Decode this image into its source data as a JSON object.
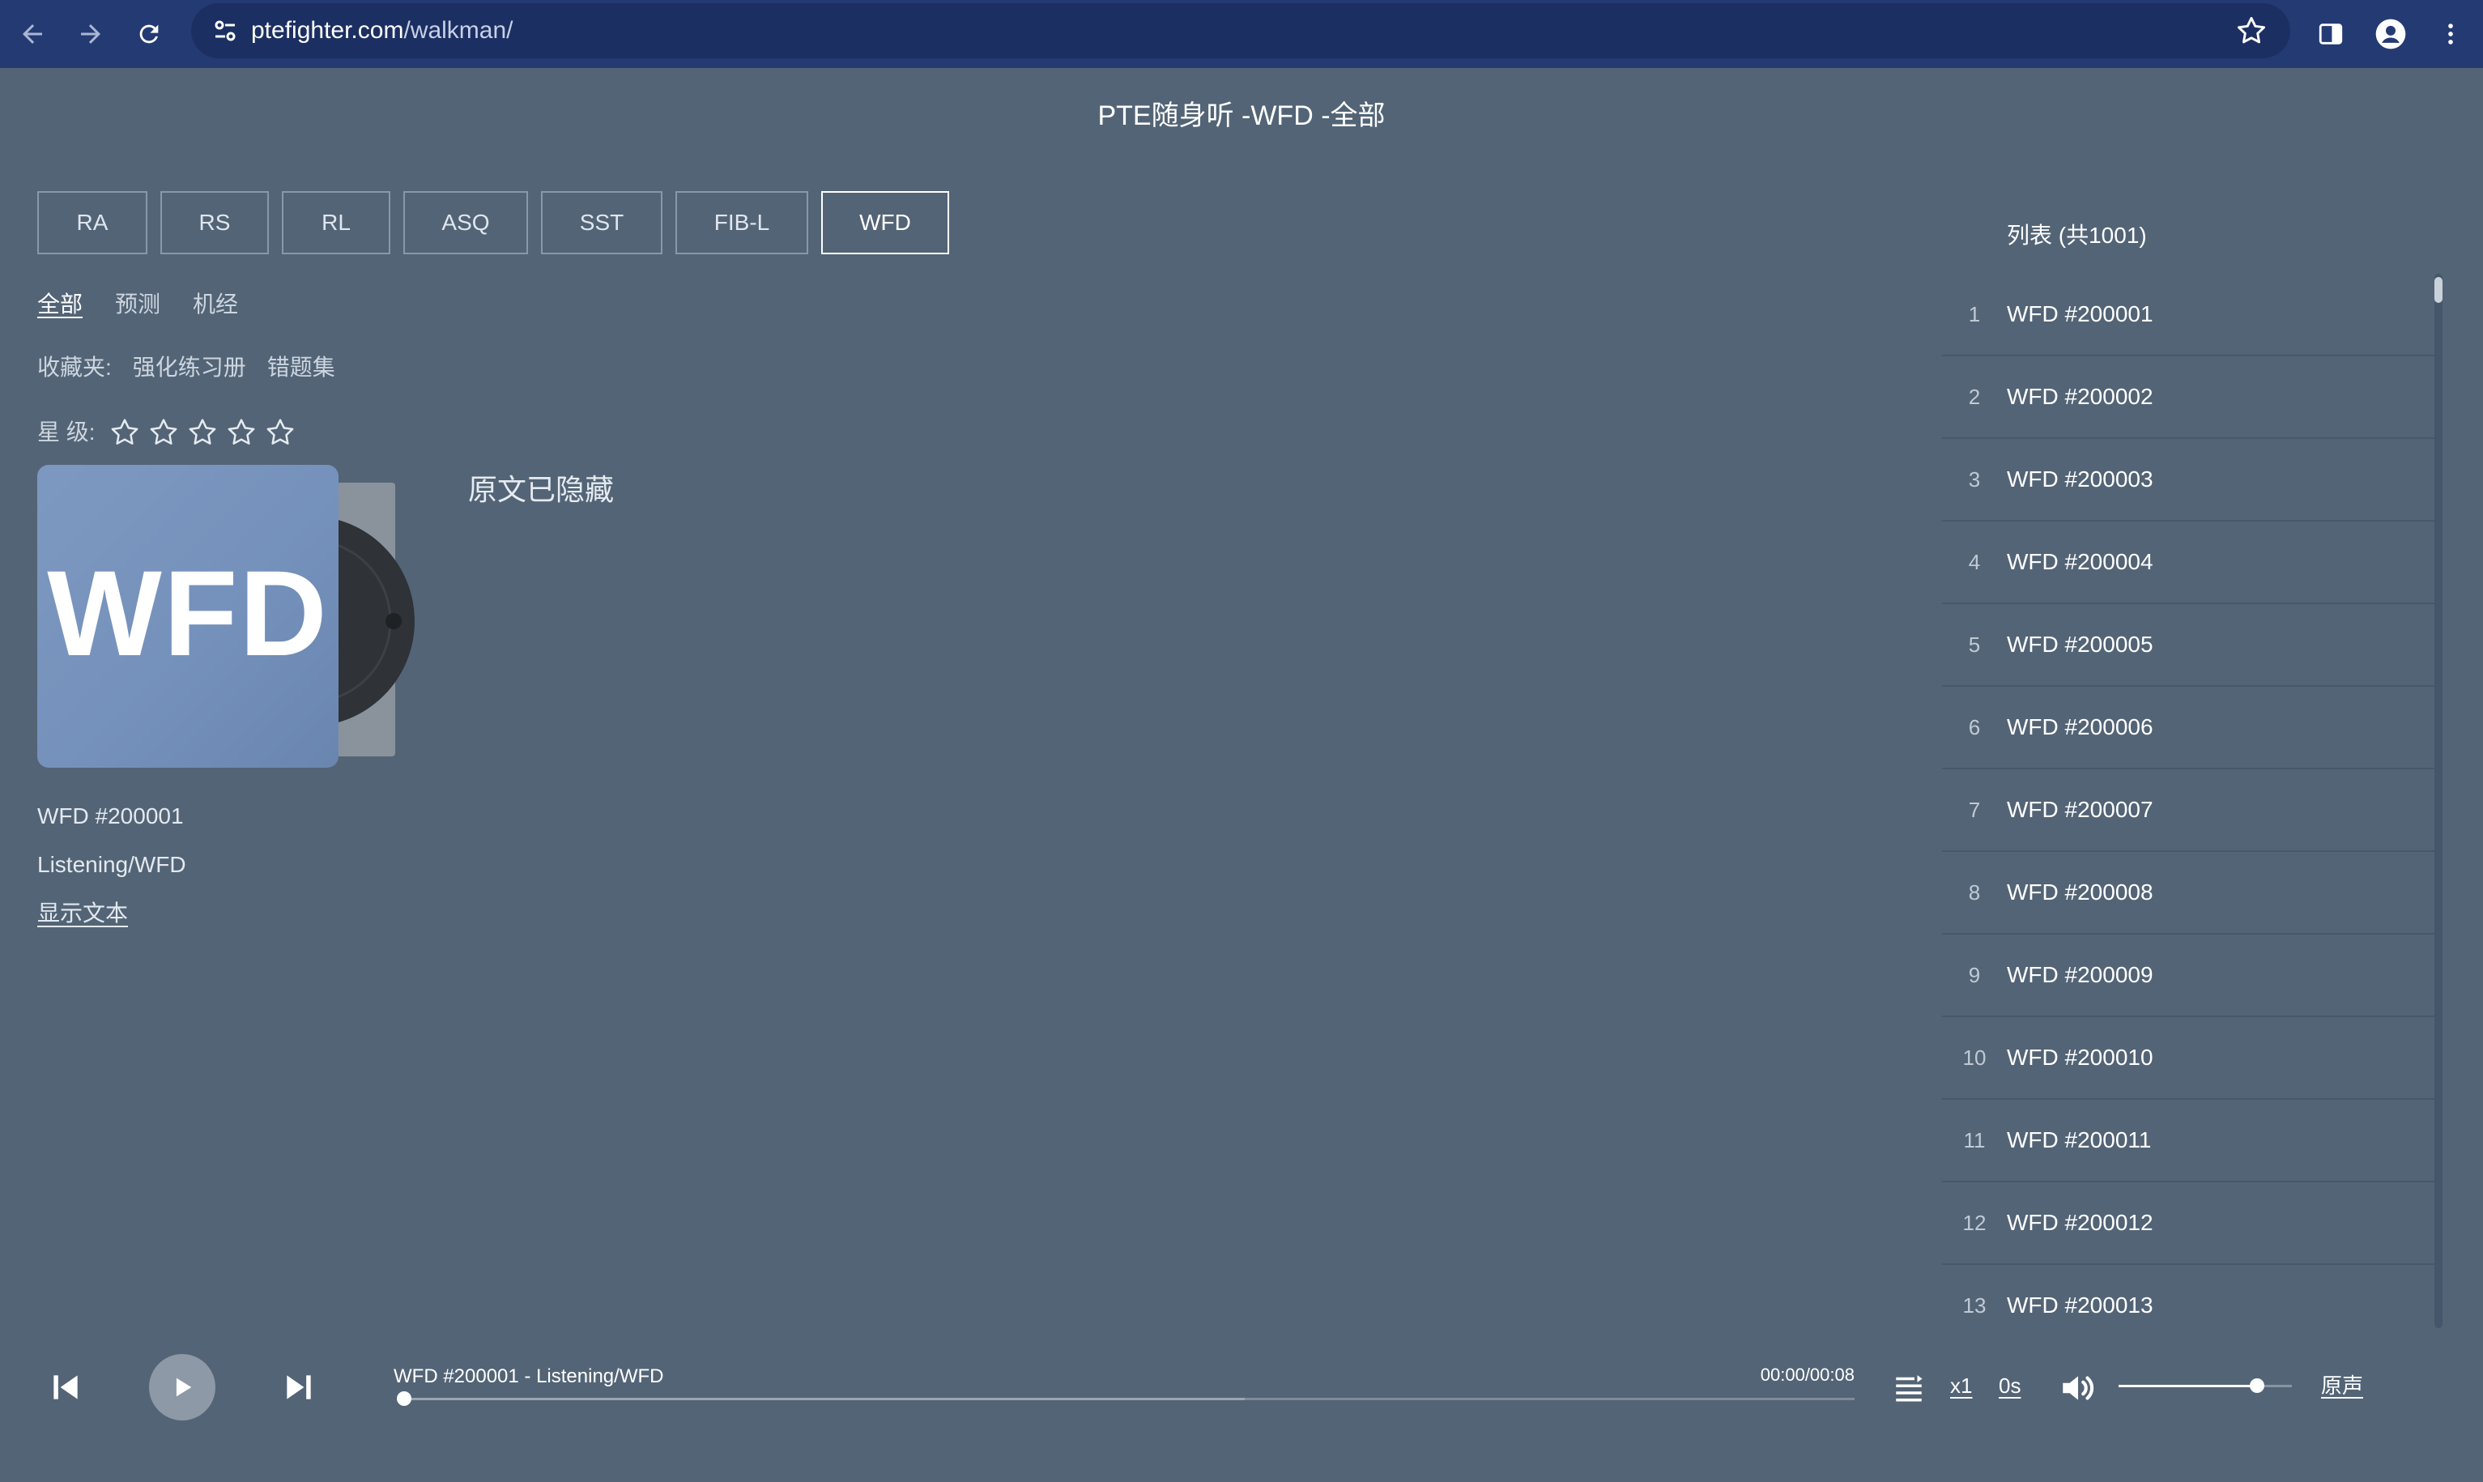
{
  "browser": {
    "url_host": "ptefighter.com",
    "url_path": "/walkman/",
    "icons": [
      "back-icon",
      "forward-icon",
      "reload-icon",
      "site-settings-icon",
      "bookmark-star-icon",
      "side-panel-icon",
      "profile-icon",
      "more-menu-icon"
    ]
  },
  "page": {
    "title": "PTE随身听 -WFD -全部"
  },
  "category_tabs": [
    {
      "label": "RA",
      "active": false
    },
    {
      "label": "RS",
      "active": false
    },
    {
      "label": "RL",
      "active": false
    },
    {
      "label": "ASQ",
      "active": false
    },
    {
      "label": "SST",
      "active": false
    },
    {
      "label": "FIB-L",
      "active": false
    },
    {
      "label": "WFD",
      "active": true
    }
  ],
  "filters": [
    {
      "label": "全部",
      "active": true
    },
    {
      "label": "预测",
      "active": false
    },
    {
      "label": "机经",
      "active": false
    }
  ],
  "favorites": {
    "label": "收藏夹:",
    "items": [
      "强化练习册",
      "错题集"
    ]
  },
  "rating": {
    "label": "星 级:",
    "max": 5,
    "value": 0
  },
  "album": {
    "cover_text": "WFD",
    "cover_color": "#6f8db9"
  },
  "track": {
    "title": "WFD #200001",
    "subtitle": "Listening/WFD",
    "show_text_link": "显示文本"
  },
  "transcript": {
    "hidden_message": "原文已隐藏"
  },
  "playlist": {
    "header": "列表 (共1001)",
    "items": [
      {
        "num": "1",
        "name": "WFD #200001"
      },
      {
        "num": "2",
        "name": "WFD #200002"
      },
      {
        "num": "3",
        "name": "WFD #200003"
      },
      {
        "num": "4",
        "name": "WFD #200004"
      },
      {
        "num": "5",
        "name": "WFD #200005"
      },
      {
        "num": "6",
        "name": "WFD #200006"
      },
      {
        "num": "7",
        "name": "WFD #200007"
      },
      {
        "num": "8",
        "name": "WFD #200008"
      },
      {
        "num": "9",
        "name": "WFD #200009"
      },
      {
        "num": "10",
        "name": "WFD #200010"
      },
      {
        "num": "11",
        "name": "WFD #200011"
      },
      {
        "num": "12",
        "name": "WFD #200012"
      },
      {
        "num": "13",
        "name": "WFD #200013"
      }
    ]
  },
  "player": {
    "now_playing": "WFD #200001 - Listening/WFD",
    "time": "00:00/00:08",
    "progress": 0.0,
    "buffered": 0.58,
    "speed": "x1",
    "interval": "0s",
    "volume": 0.8,
    "voice_mode": "原声"
  },
  "colors": {
    "page_background": "#536476",
    "browser_bar": "#243a73",
    "accent_white": "#ffffff"
  }
}
